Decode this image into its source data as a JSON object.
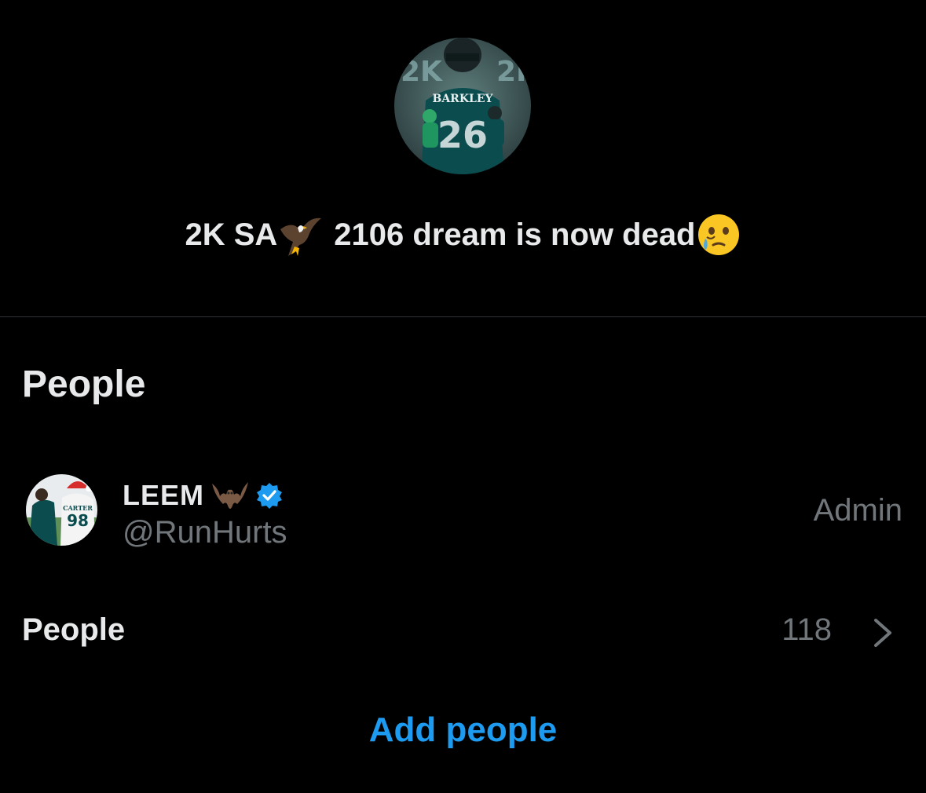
{
  "group": {
    "name_prefix": "2K SA",
    "name_suffix": "2106 dream is now dead",
    "name_emoji_1": "eagle-emoji",
    "name_emoji_2": "face-holding-back-tears-emoji"
  },
  "people_section": {
    "title": "People"
  },
  "member": {
    "display_name": "LEEM",
    "name_emoji": "bat-emoji",
    "verified": true,
    "handle": "@RunHurts",
    "role": "Admin"
  },
  "people_row": {
    "label": "People",
    "count": "118"
  },
  "actions": {
    "add_people": "Add people"
  },
  "colors": {
    "background": "#000000",
    "primary_text": "#e7e9ea",
    "secondary_text": "#71767b",
    "accent": "#1d9bf0",
    "divider": "#2f3336"
  }
}
